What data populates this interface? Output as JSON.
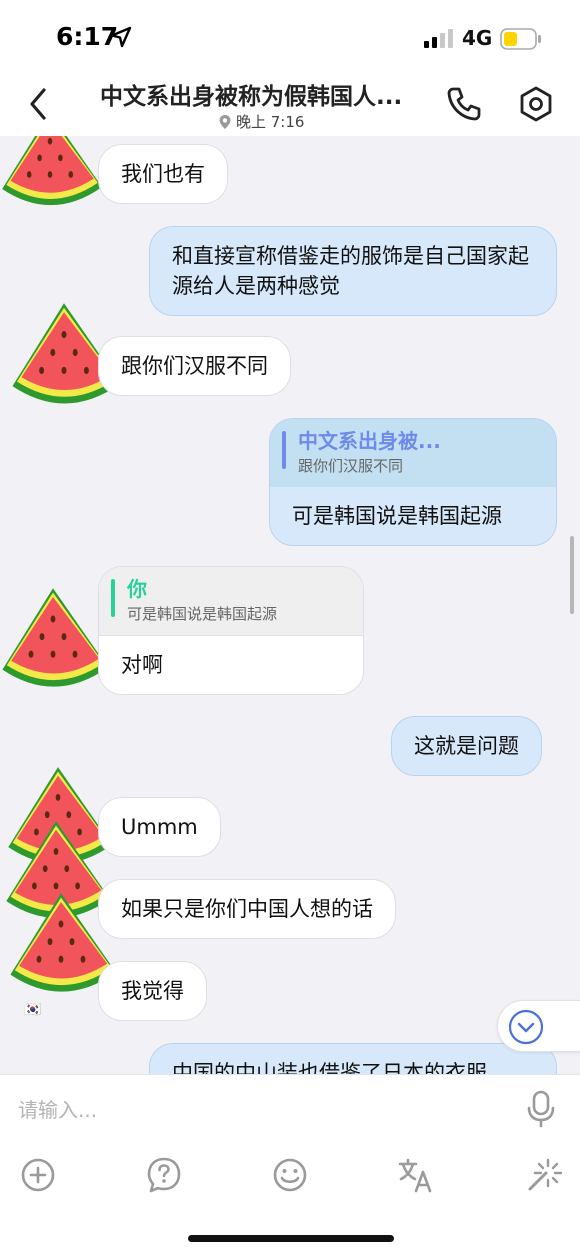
{
  "status_bar": {
    "time": "6:17",
    "network": "4G",
    "battery_color": "#ffd400"
  },
  "header": {
    "title": "中文系出身被称为假韩国人...",
    "subtitle": "晚上 7:16"
  },
  "messages": {
    "m1": "我们也有",
    "m2": "和直接宣称借鉴走的服饰是自己国家起源给人是两种感觉",
    "m3": "跟你们汉服不同",
    "m4_quote_name": "中文系出身被...",
    "m4_quote_text": "跟你们汉服不同",
    "m4_text": "可是韩国说是韩国起源",
    "m5_quote_name": "你",
    "m5_quote_text": "可是韩国说是韩国起源",
    "m5_text": "对啊",
    "m6": "这就是问题",
    "m7": "Ummm",
    "m8": "如果只是你们中国人想的话",
    "m9": "我觉得",
    "m10": "中国的中山装也借鉴了日本的衣服"
  },
  "input": {
    "placeholder": "请输入..."
  },
  "colors": {
    "outgoing_bubble": "#d7e8fb",
    "incoming_bubble": "#ffffff",
    "quote_out_accent": "#6f8bea",
    "quote_in_accent": "#2bcf9c"
  }
}
